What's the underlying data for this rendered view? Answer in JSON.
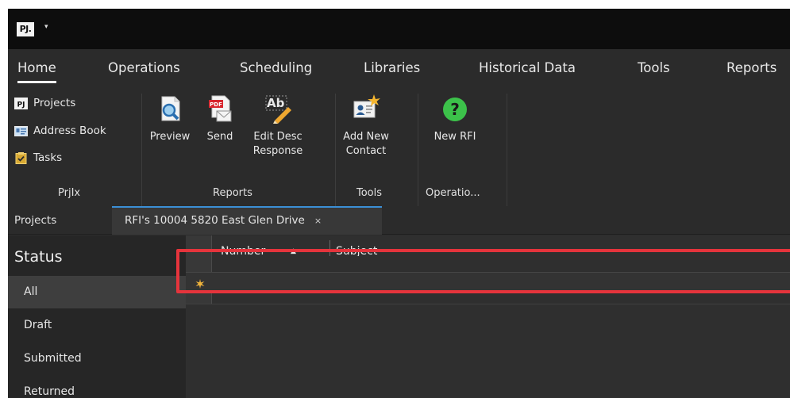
{
  "app": {
    "logo_text": "PJ.",
    "quick_access_arrow": "▾"
  },
  "menu": {
    "tabs": [
      {
        "label": "Home"
      },
      {
        "label": "Operations"
      },
      {
        "label": "Scheduling"
      },
      {
        "label": "Libraries"
      },
      {
        "label": "Historical Data"
      },
      {
        "label": "Tools"
      },
      {
        "label": "Reports"
      }
    ],
    "active_tab": "Home"
  },
  "ribbon": {
    "prjix": {
      "label": "PrjIx",
      "items": [
        {
          "label": "Projects",
          "icon": "pj-logo-icon"
        },
        {
          "label": "Address Book",
          "icon": "address-card-icon"
        },
        {
          "label": "Tasks",
          "icon": "clipboard-icon"
        }
      ]
    },
    "reports": {
      "label": "Reports",
      "preview": "Preview",
      "send": "Send",
      "edit_desc_line1": "Edit Desc",
      "edit_desc_line2": "Response",
      "pdf_badge": "PDF",
      "ab_text": "Ab"
    },
    "tools": {
      "label": "Tools",
      "add_new_line1": "Add New",
      "add_new_line2": "Contact"
    },
    "operations": {
      "label": "Operatio...",
      "new_rfi": "New RFI",
      "question_mark": "?"
    }
  },
  "doc_tabs": {
    "projects": "Projects",
    "rfi": "RFI's 10004 5820 East Glen Drive",
    "close": "×"
  },
  "status": {
    "title": "Status",
    "items": [
      "All",
      "Draft",
      "Submitted",
      "Returned"
    ],
    "selected": "All"
  },
  "grid": {
    "columns": [
      "Number",
      "Subject"
    ],
    "sort_indicator": "▲"
  },
  "colors": {
    "accent_tab": "#3b8fd6",
    "highlight": "#e5343c",
    "new_row_star": "#f0b43c",
    "help_green": "#3cc24a"
  }
}
